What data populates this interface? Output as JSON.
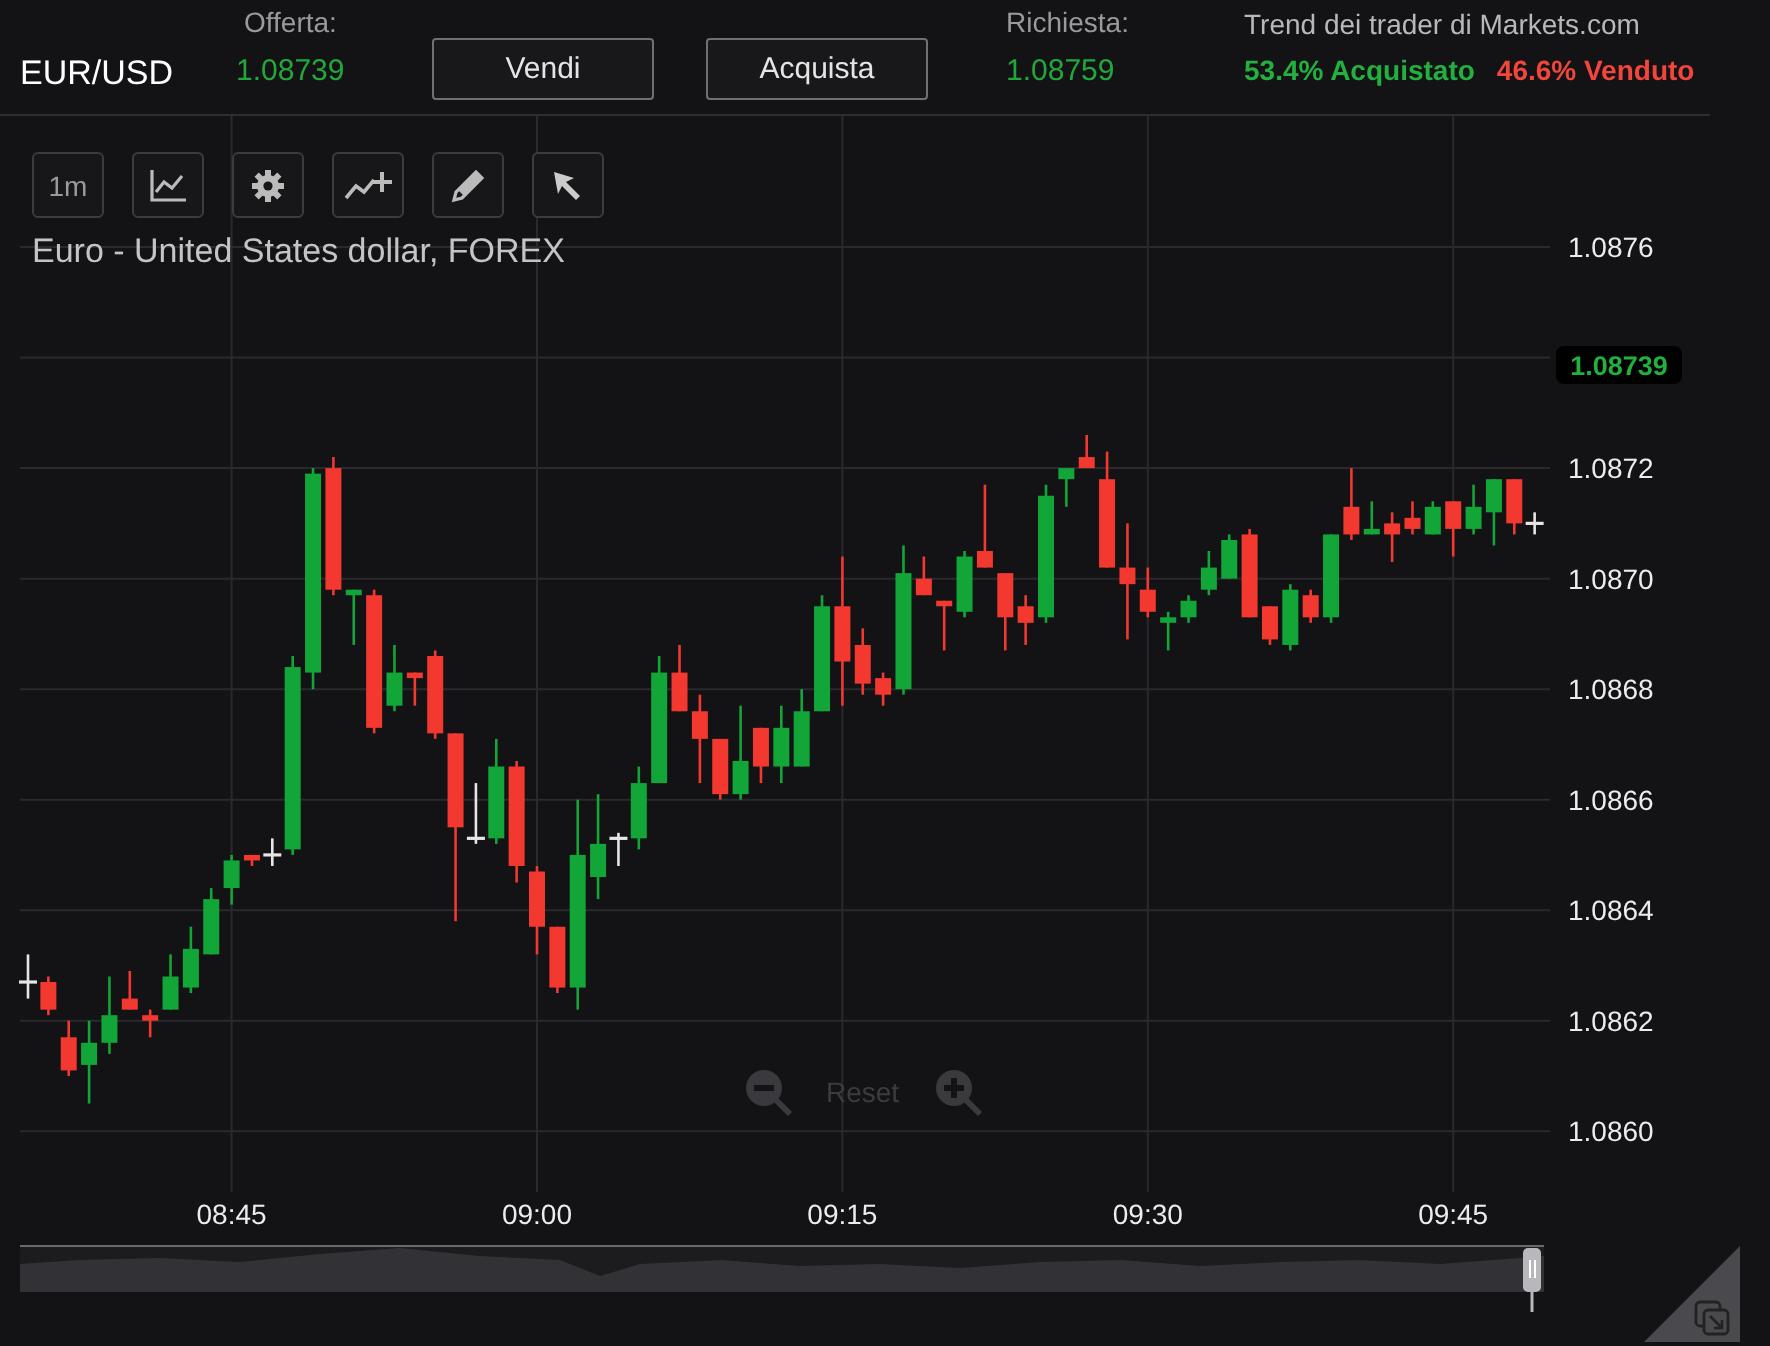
{
  "header": {
    "symbol": "EUR/USD",
    "offer": {
      "label": "Offerta:",
      "value": "1.08739"
    },
    "buttons": [
      "Vendi",
      "Acquista"
    ],
    "ask": {
      "label": "Richiesta:",
      "value": "1.08759"
    },
    "trend": {
      "title": "Trend dei trader di Markets.com",
      "buy": "53.4% Acquistato",
      "sell": "46.6% Venduto"
    }
  },
  "toolbar": [
    {
      "kind": "interval",
      "label": "1m"
    },
    {
      "kind": "chart-type"
    },
    {
      "kind": "settings"
    },
    {
      "kind": "indicators"
    },
    {
      "kind": "draw"
    },
    {
      "kind": "cursor"
    }
  ],
  "chart": {
    "price_tag": "1.08739",
    "reset": "Reset",
    "chart_data": {
      "type": "candlestick",
      "title": "Euro - United States dollar, FOREX",
      "categories": [
        null,
        null,
        null,
        null,
        null,
        null,
        null,
        null,
        null,
        null,
        "08:45",
        null,
        null,
        null,
        null,
        null,
        null,
        null,
        null,
        null,
        null,
        null,
        null,
        null,
        null,
        "09:00",
        null,
        null,
        null,
        null,
        null,
        null,
        null,
        null,
        null,
        null,
        null,
        null,
        null,
        null,
        "09:15",
        null,
        null,
        null,
        null,
        null,
        null,
        null,
        null,
        null,
        null,
        null,
        null,
        null,
        null,
        "09:30",
        null,
        null,
        null,
        null,
        null,
        null,
        null,
        null,
        null,
        null,
        null,
        null,
        null,
        null,
        "09:45",
        null,
        null,
        null,
        null
      ],
      "ohlc": [
        [
          1.08627,
          1.08632,
          1.08624,
          1.08627
        ],
        [
          1.08627,
          1.08628,
          1.08621,
          1.08622
        ],
        [
          1.08617,
          1.0862,
          1.0861,
          1.08611
        ],
        [
          1.08612,
          1.0862,
          1.08605,
          1.08616
        ],
        [
          1.08616,
          1.08628,
          1.08614,
          1.08621
        ],
        [
          1.08624,
          1.08629,
          1.08622,
          1.08622
        ],
        [
          1.08621,
          1.08622,
          1.08617,
          1.0862
        ],
        [
          1.08622,
          1.08632,
          1.08622,
          1.08628
        ],
        [
          1.08626,
          1.08637,
          1.08625,
          1.08633
        ],
        [
          1.08632,
          1.08644,
          1.08632,
          1.08642
        ],
        [
          1.08644,
          1.0865,
          1.08641,
          1.08649
        ],
        [
          1.0865,
          1.0865,
          1.08648,
          1.08649
        ],
        [
          1.0865,
          1.08653,
          1.08648,
          1.0865
        ],
        [
          1.08651,
          1.08686,
          1.0865,
          1.08684
        ],
        [
          1.08683,
          1.0872,
          1.0868,
          1.08719
        ],
        [
          1.0872,
          1.08722,
          1.08697,
          1.08698
        ],
        [
          1.08697,
          1.08698,
          1.08688,
          1.08698
        ],
        [
          1.08697,
          1.08698,
          1.08672,
          1.08673
        ],
        [
          1.08677,
          1.08688,
          1.08676,
          1.08683
        ],
        [
          1.08683,
          1.08683,
          1.08677,
          1.08682
        ],
        [
          1.08686,
          1.08687,
          1.08671,
          1.08672
        ],
        [
          1.08672,
          1.08672,
          1.08638,
          1.08655
        ],
        [
          1.08653,
          1.08663,
          1.08652,
          1.08653
        ],
        [
          1.08653,
          1.08671,
          1.08652,
          1.08666
        ],
        [
          1.08666,
          1.08667,
          1.08645,
          1.08648
        ],
        [
          1.08647,
          1.08648,
          1.08632,
          1.08637
        ],
        [
          1.08637,
          1.08637,
          1.08625,
          1.08626
        ],
        [
          1.08626,
          1.0866,
          1.08622,
          1.0865
        ],
        [
          1.08646,
          1.08661,
          1.08642,
          1.08652
        ],
        [
          1.08653,
          1.08654,
          1.08648,
          1.08653
        ],
        [
          1.08653,
          1.08666,
          1.08651,
          1.08663
        ],
        [
          1.08663,
          1.08686,
          1.08663,
          1.08683
        ],
        [
          1.08683,
          1.08688,
          1.08676,
          1.08676
        ],
        [
          1.08676,
          1.08679,
          1.08663,
          1.08671
        ],
        [
          1.08671,
          1.08671,
          1.0866,
          1.08661
        ],
        [
          1.08661,
          1.08677,
          1.0866,
          1.08667
        ],
        [
          1.08673,
          1.08673,
          1.08663,
          1.08666
        ],
        [
          1.08666,
          1.08677,
          1.08663,
          1.08673
        ],
        [
          1.08666,
          1.0868,
          1.08666,
          1.08676
        ],
        [
          1.08676,
          1.08697,
          1.08676,
          1.08695
        ],
        [
          1.08695,
          1.08704,
          1.08677,
          1.08685
        ],
        [
          1.08688,
          1.08691,
          1.08679,
          1.08681
        ],
        [
          1.08682,
          1.08683,
          1.08677,
          1.08679
        ],
        [
          1.0868,
          1.08706,
          1.08679,
          1.08701
        ],
        [
          1.087,
          1.08704,
          1.08697,
          1.08697
        ],
        [
          1.08696,
          1.08696,
          1.08687,
          1.08695
        ],
        [
          1.08694,
          1.08705,
          1.08693,
          1.08704
        ],
        [
          1.08705,
          1.08717,
          1.08702,
          1.08702
        ],
        [
          1.08701,
          1.08701,
          1.08687,
          1.08693
        ],
        [
          1.08695,
          1.08697,
          1.08688,
          1.08692
        ],
        [
          1.08693,
          1.08717,
          1.08692,
          1.08715
        ],
        [
          1.08718,
          1.0872,
          1.08713,
          1.0872
        ],
        [
          1.08722,
          1.08726,
          1.0872,
          1.0872
        ],
        [
          1.08718,
          1.08723,
          1.08702,
          1.08702
        ],
        [
          1.08702,
          1.0871,
          1.08689,
          1.08699
        ],
        [
          1.08698,
          1.08702,
          1.08693,
          1.08694
        ],
        [
          1.08692,
          1.08694,
          1.08687,
          1.08693
        ],
        [
          1.08693,
          1.08697,
          1.08692,
          1.08696
        ],
        [
          1.08698,
          1.08705,
          1.08697,
          1.08702
        ],
        [
          1.087,
          1.08708,
          1.087,
          1.08707
        ],
        [
          1.08708,
          1.08709,
          1.08693,
          1.08693
        ],
        [
          1.08695,
          1.08695,
          1.08688,
          1.08689
        ],
        [
          1.08688,
          1.08699,
          1.08687,
          1.08698
        ],
        [
          1.08697,
          1.08698,
          1.08692,
          1.08693
        ],
        [
          1.08693,
          1.08708,
          1.08692,
          1.08708
        ],
        [
          1.08713,
          1.0872,
          1.08707,
          1.08708
        ],
        [
          1.08708,
          1.08714,
          1.08708,
          1.08709
        ],
        [
          1.0871,
          1.08712,
          1.08703,
          1.08708
        ],
        [
          1.08711,
          1.08714,
          1.08708,
          1.08709
        ],
        [
          1.08708,
          1.08714,
          1.08708,
          1.08713
        ],
        [
          1.08714,
          1.08714,
          1.08704,
          1.08709
        ],
        [
          1.08709,
          1.08717,
          1.08708,
          1.08713
        ],
        [
          1.08712,
          1.08718,
          1.08706,
          1.08718
        ],
        [
          1.08718,
          1.08718,
          1.08708,
          1.0871
        ],
        [
          1.0871,
          1.08712,
          1.08708,
          1.0871
        ]
      ],
      "grid": true,
      "ylim": [
        1.08589,
        1.08783
      ],
      "yticks": [
        {
          "value": 1.0876,
          "label": "1.0876"
        },
        {
          "value": 1.0872,
          "label": "1.0872"
        },
        {
          "value": 1.087,
          "label": "1.0870"
        },
        {
          "value": 1.0868,
          "label": "1.0868"
        },
        {
          "value": 1.0866,
          "label": "1.0866"
        },
        {
          "value": 1.0864,
          "label": "1.0864"
        },
        {
          "value": 1.0862,
          "label": "1.0862"
        },
        {
          "value": 1.086,
          "label": "1.0860"
        }
      ]
    }
  }
}
